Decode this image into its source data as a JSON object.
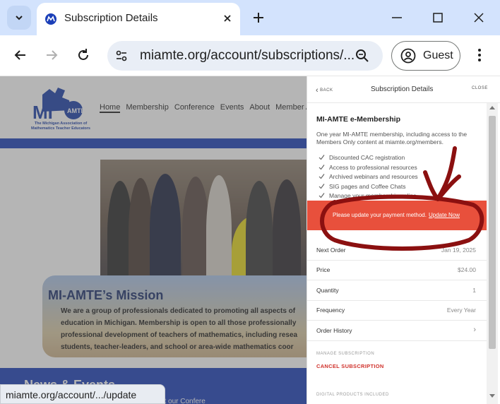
{
  "browser": {
    "tab_title": "Subscription Details",
    "url": "miamte.org/account/subscriptions/...",
    "profile_label": "Guest",
    "status_url": "miamte.org/account/.../update"
  },
  "site": {
    "logo_caption": "The Michigan Association of Mathematics Teacher Educators",
    "nav": [
      "Home",
      "Membership",
      "Conference",
      "Events",
      "About",
      "Member A"
    ],
    "mission_title": "MI-AMTE’s Mission",
    "mission_lines": [
      "We are a group of professionals dedicated to promoting all aspects of",
      "education in Michigan. Membership is open to all those professionally",
      "professional development of teachers of mathematics, including resea",
      "students, teacher-leaders, and school or area-wide mathematics coor"
    ],
    "news_title": "News & Events",
    "news_text": "...see the upcoming events. Please check out our Confere"
  },
  "panel": {
    "back_label": "BACK",
    "title": "Subscription Details",
    "close_label": "CLOSE",
    "product_name": "MI-AMTE e-Membership",
    "product_desc": "One year MI-AMTE membership, including access to the Members Only content at miamte.org/members.",
    "benefits": [
      "Discounted CAC registration",
      "Access to professional resources",
      "Archived webinars and resources",
      "SIG pages and Coffee Chats",
      "Manage your membership online"
    ],
    "alert_text": "Please update your payment method.",
    "alert_link": "Update Now",
    "rows": {
      "next_order": {
        "label": "Next Order",
        "value": "Jan 19, 2025"
      },
      "price": {
        "label": "Price",
        "value": "$24.00"
      },
      "quantity": {
        "label": "Quantity",
        "value": "1"
      },
      "frequency": {
        "label": "Frequency",
        "value": "Every Year"
      },
      "order_history": {
        "label": "Order History"
      }
    },
    "manage_label": "MANAGE SUBSCRIPTION",
    "cancel_label": "CANCEL SUBSCRIPTION",
    "digital_label": "DIGITAL PRODUCTS INCLUDED"
  },
  "colors": {
    "alert_bg": "#e8503c",
    "cancel_red": "#d0322c",
    "tabstrip": "#d3e3fd",
    "site_blue": "#1b3fb8",
    "annotation_ink": "#8b1010"
  }
}
